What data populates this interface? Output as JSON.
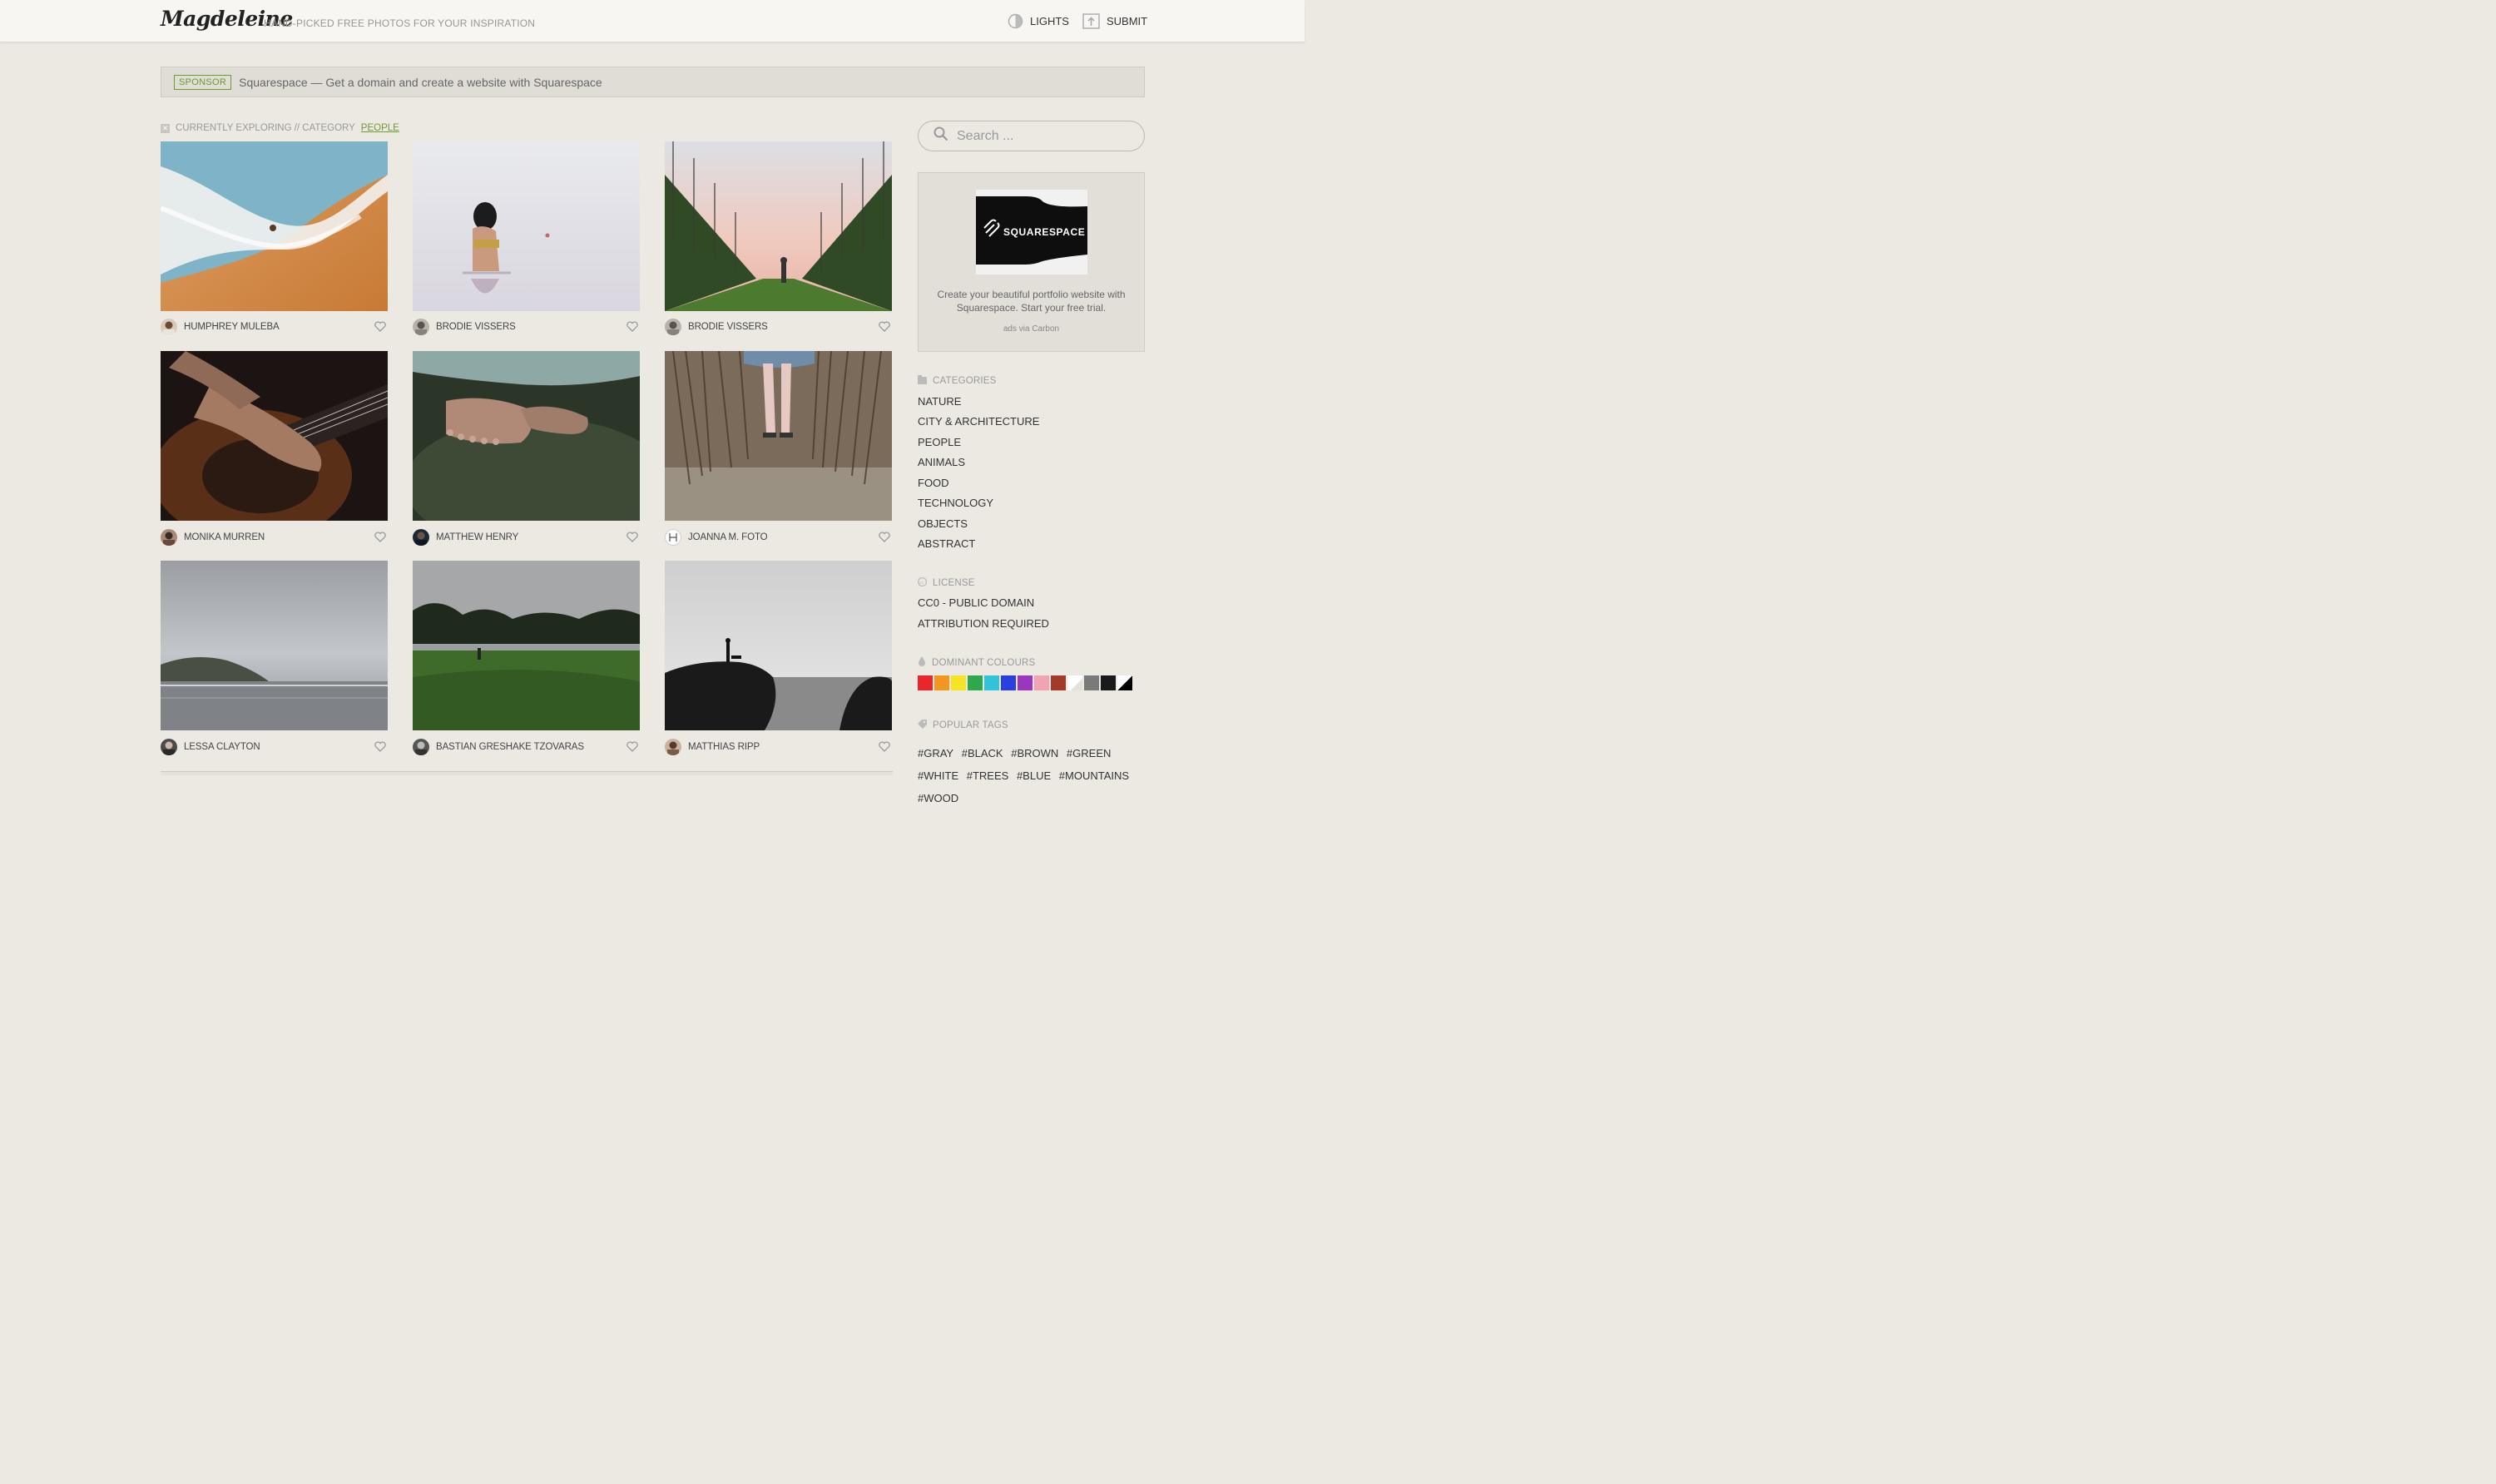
{
  "header": {
    "logo": "Magdeleine",
    "tagline": "HAND-PICKED FREE PHOTOS FOR YOUR INSPIRATION",
    "lights_label": "LIGHTS",
    "submit_label": "SUBMIT"
  },
  "sponsor": {
    "badge": "SPONSOR",
    "text": "Squarespace — Get a domain and create a website with Squarespace"
  },
  "exploring": {
    "prefix": "CURRENTLY EXPLORING // CATEGORY",
    "category": "PEOPLE"
  },
  "photos": [
    {
      "author": "HUMPHREY MULEBA",
      "subject": "aerial beach waves on sand"
    },
    {
      "author": "BRODIE VISSERS",
      "subject": "woman standing in calm water"
    },
    {
      "author": "BRODIE VISSERS",
      "subject": "person walking between orchard rows"
    },
    {
      "author": "MONIKA MURREN",
      "subject": "hands playing acoustic guitar"
    },
    {
      "author": "MATTHEW HENRY",
      "subject": "bare feet on mossy rock"
    },
    {
      "author": "JOANNA M. FOTO",
      "subject": "legs walking through tall grass"
    },
    {
      "author": "LESSA CLAYTON",
      "subject": "cloudy sky over grey beach"
    },
    {
      "author": "BASTIAN GRESHAKE TZOVARAS",
      "subject": "person on green field by trees"
    },
    {
      "author": "MATTHIAS RIPP",
      "subject": "silhouette with dog on rocks by sea"
    }
  ],
  "search": {
    "placeholder": "Search ..."
  },
  "ad": {
    "brand": "SQUARESPACE",
    "text": "Create your beautiful portfolio website with Squarespace. Start your free trial.",
    "via": "ads via Carbon"
  },
  "categories": {
    "heading": "CATEGORIES",
    "items": [
      "NATURE",
      "CITY & ARCHITECTURE",
      "PEOPLE",
      "ANIMALS",
      "FOOD",
      "TECHNOLOGY",
      "OBJECTS",
      "ABSTRACT"
    ]
  },
  "license": {
    "heading": "LICENSE",
    "items": [
      "CC0 - PUBLIC DOMAIN",
      "ATTRIBUTION REQUIRED"
    ]
  },
  "colours": {
    "heading": "DOMINANT COLOURS",
    "swatches": [
      "#e8262b",
      "#f39521",
      "#f4e425",
      "#2ea84a",
      "#31c3d7",
      "#2b3fe0",
      "#9b37bc",
      "#f1a3b4",
      "#a33a2a",
      "#ffffff",
      "#7a7a7a",
      "#1a1a1a",
      "#000000"
    ]
  },
  "tags": {
    "heading": "POPULAR TAGS",
    "items": [
      "#GRAY",
      "#BLACK",
      "#BROWN",
      "#GREEN",
      "#WHITE",
      "#TREES",
      "#BLUE",
      "#MOUNTAINS",
      "#WOOD"
    ]
  }
}
